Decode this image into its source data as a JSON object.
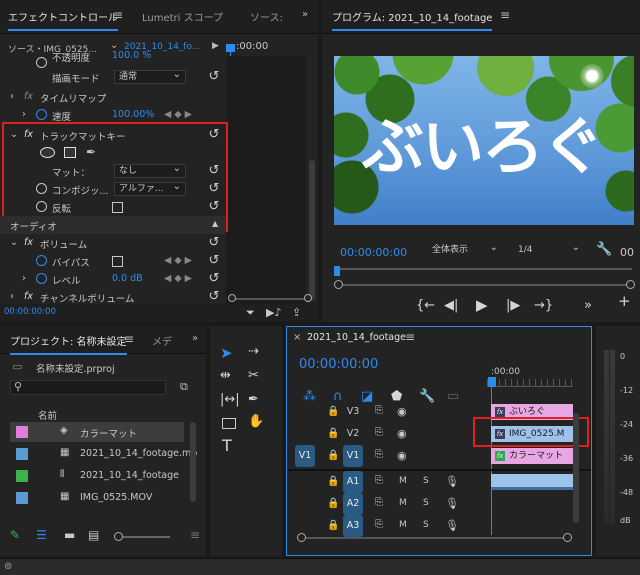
{
  "effect_controls": {
    "tabs": [
      "エフェクトコントロール",
      "Lumetri スコープ",
      "ソース:"
    ],
    "source_label": "ソース・IMG_0525...",
    "clip_label": "2021_10_14_fo...",
    "time_ruler": ":00:00",
    "rows": {
      "opacity_label": "不透明度",
      "opacity_value": "100.0 %",
      "blend_label": "描画モード",
      "blend_value": "通常",
      "remap_label": "タイムリマップ",
      "speed_label": "速度",
      "speed_value": "100.00%",
      "track_matte_label": "トラックマットキー",
      "matte_label": "マット：",
      "matte_value": "なし",
      "composite_label": "コンポジッ...",
      "composite_value": "アルファ...",
      "invert_label": "反転",
      "audio_label": "オーディオ",
      "volume_label": "ボリューム",
      "bypass_label": "バイパス",
      "level_label": "レベル",
      "level_value": "0.0 dB",
      "channel_volume_label": "チャンネルボリューム"
    },
    "timecode": "00:00:00:00"
  },
  "program": {
    "title": "プログラム: 2021_10_14_footage",
    "overlay_text": "ぶいろぐ",
    "timecode": "00:00:00:00",
    "zoom": "全体表示",
    "resolution": "1/4",
    "end_timecode": "00"
  },
  "project": {
    "tab": "プロジェクト: 名称未設定",
    "tab2": "メデ",
    "file": "名称未設定.prproj",
    "column": "名前",
    "items": [
      {
        "name": "カラーマット",
        "color": "#e07ee0"
      },
      {
        "name": "2021_10_14_footage.mp",
        "color": "#5a9bd6"
      },
      {
        "name": "2021_10_14_footage",
        "color": "#3db24a"
      },
      {
        "name": "IMG_0525.MOV",
        "color": "#5a9bd6"
      }
    ]
  },
  "timeline": {
    "title": "2021_10_14_footage",
    "timecode": "00:00:00:00",
    "ruler": ":00:00",
    "video_tracks": [
      "V3",
      "V2",
      "V1"
    ],
    "audio_tracks": [
      "A1",
      "A2",
      "A3"
    ],
    "source_patch_v": "V1",
    "m_label": "M",
    "s_label": "S",
    "clips": {
      "v3": "ぶいろぐ",
      "v2": "IMG_0525.M",
      "v1": "カラーマット"
    },
    "fx_label": "fx"
  },
  "meter": {
    "labels": [
      "0",
      "-12",
      "-24",
      "-36",
      "-48",
      "dB"
    ]
  },
  "colors": {
    "accent": "#2d8ceb",
    "highlight": "#e02020",
    "clip_pink": "#e7a6e4",
    "clip_green": "#2fa84a"
  }
}
